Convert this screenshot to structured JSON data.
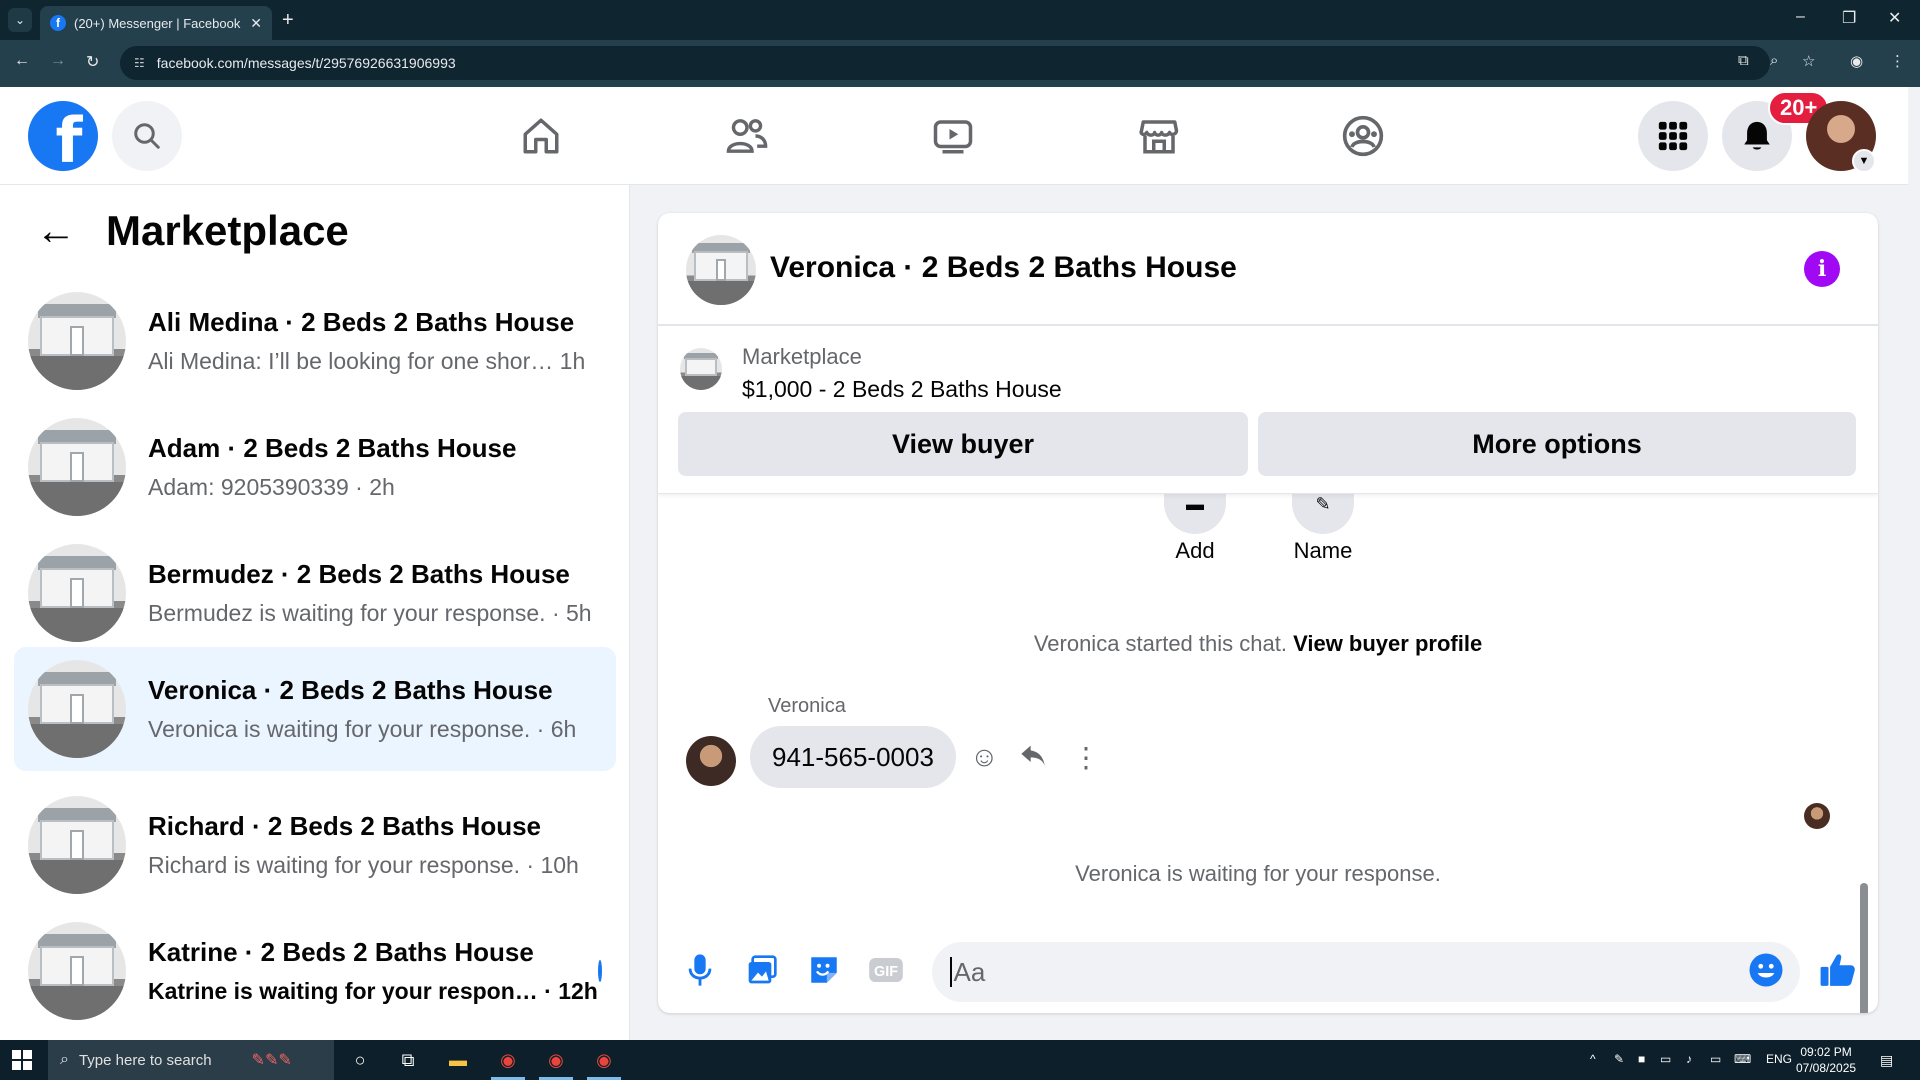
{
  "browser": {
    "tab_title": "(20+) Messenger | Facebook",
    "url": "facebook.com/messages/t/29576926631906993"
  },
  "header": {
    "notification_badge": "20+"
  },
  "sidebar": {
    "title": "Marketplace",
    "conversations": [
      {
        "name": "Ali Medina · 2 Beds 2 Baths House",
        "preview": "Ali Medina: I’ll be looking for one shor… 1h",
        "active": false,
        "unread": false
      },
      {
        "name": "Adam · 2 Beds 2 Baths House",
        "preview": "Adam: 9205390339 · 2h",
        "active": false,
        "unread": false
      },
      {
        "name": "Bermudez · 2 Beds 2 Baths House",
        "preview": "Bermudez is waiting for your response. · 5h",
        "active": false,
        "unread": false
      },
      {
        "name": "Veronica · 2 Beds 2 Baths House",
        "preview": "Veronica is waiting for your response. · 6h",
        "active": true,
        "unread": false
      },
      {
        "name": "Richard · 2 Beds 2 Baths House",
        "preview": "Richard is waiting for your response. · 10h",
        "active": false,
        "unread": false
      },
      {
        "name": "Katrine · 2 Beds 2 Baths House",
        "preview": "Katrine is waiting for your respon… · 12h",
        "active": false,
        "unread": true
      }
    ]
  },
  "chat": {
    "title": "Veronica · 2 Beds 2 Baths House",
    "marketplace_label": "Marketplace",
    "listing": "$1,000 - 2 Beds 2 Baths House",
    "view_buyer": "View buyer",
    "more_options": "More options",
    "quick_actions": [
      "Add",
      "Name"
    ],
    "started_text": "Veronica started this chat.",
    "view_buyer_profile": "View buyer profile",
    "sender": "Veronica",
    "message": "941-565-0003",
    "waiting_text": "Veronica is waiting for your response.",
    "composer_placeholder": "Aa"
  },
  "taskbar": {
    "search_placeholder": "Type here to search",
    "language": "ENG",
    "time": "09:02 PM",
    "date": "07/08/2025"
  },
  "colors": {
    "fb_blue": "#1877f2",
    "active_conv": "#ebf5ff",
    "info_purple": "#a109f5",
    "badge_red": "#e41e3f"
  }
}
